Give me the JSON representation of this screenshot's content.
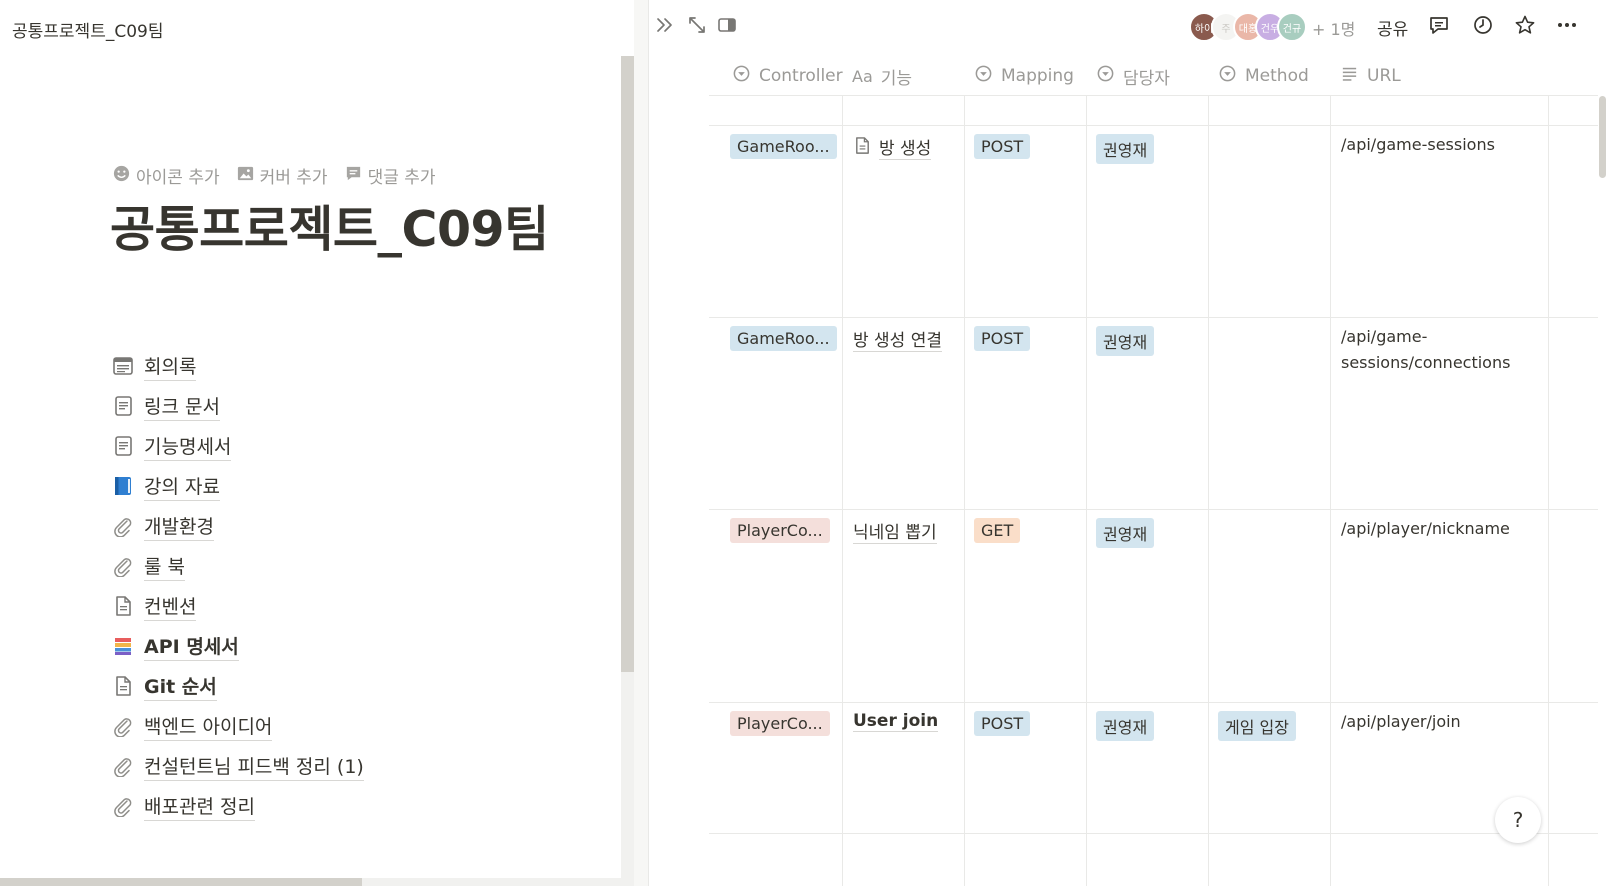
{
  "breadcrumb": "공통프로젝트_C09팀",
  "page": {
    "actions": {
      "add_icon": "아이콘 추가",
      "add_cover": "커버 추가",
      "add_comment": "댓글 추가"
    },
    "title": "공통프로젝트_C09팀",
    "sub_pages": [
      {
        "label": "회의록",
        "icon": "list-doc-icon"
      },
      {
        "label": "링크 문서",
        "icon": "page-icon"
      },
      {
        "label": "기능명세서",
        "icon": "page-icon"
      },
      {
        "label": "강의 자료",
        "icon": "blue-book-icon"
      },
      {
        "label": "개발환경",
        "icon": "paperclip-icon"
      },
      {
        "label": "룰 북",
        "icon": "paperclip-icon"
      },
      {
        "label": "컨벤션",
        "icon": "text-doc-icon"
      },
      {
        "label": "API 명세서",
        "icon": "books-icon"
      },
      {
        "label": "Git 순서",
        "icon": "text-doc-icon"
      },
      {
        "label": "백엔드 아이디어",
        "icon": "paperclip-icon"
      },
      {
        "label": "컨설턴트님 피드백 정리 (1)",
        "icon": "paperclip-icon"
      },
      {
        "label": "배포관련 정리",
        "icon": "paperclip-icon"
      }
    ]
  },
  "topbar": {
    "avatars": [
      "하이",
      "주",
      "대홍",
      "건우",
      "건규"
    ],
    "more_users": "+ 1명",
    "share": "공유"
  },
  "table": {
    "columns": {
      "controller": "Controller",
      "title_prefix": "Aa",
      "title": "기능",
      "mapping": "Mapping",
      "owner": "담당자",
      "method": "Method",
      "url": "URL"
    },
    "rows": [
      {
        "controller": "GameRoo...",
        "title": "방 생성",
        "mapping": "POST",
        "owner": "권영재",
        "method": "",
        "url": "/api/game-sessions"
      },
      {
        "controller": "GameRoo...",
        "title": "방 생성 연결",
        "mapping": "POST",
        "owner": "권영재",
        "method": "",
        "url": "/api/game-sessions/connections"
      },
      {
        "controller": "PlayerCo...",
        "title": "닉네임 뽑기",
        "mapping": "GET",
        "owner": "권영재",
        "method": "",
        "url": "/api/player/nickname"
      },
      {
        "controller": "PlayerCo...",
        "title": "User join",
        "mapping": "POST",
        "owner": "권영재",
        "method": "게임 입장",
        "url": "/api/player/join"
      }
    ]
  },
  "help": "?"
}
